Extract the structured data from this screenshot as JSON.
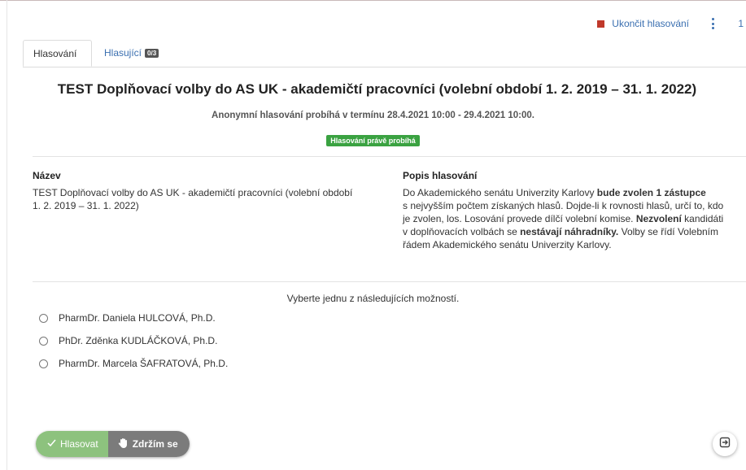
{
  "header": {
    "end_vote_label": "Ukončit hlasování",
    "cut_number": "1"
  },
  "tabs": [
    {
      "label": "Hlasování",
      "active": true
    },
    {
      "label": "Hlasující",
      "badge": "0/3",
      "active": false
    }
  ],
  "poll": {
    "title": "TEST Doplňovací volby do AS UK - akademičtí pracovníci (volební období 1. 2. 2019 – 31. 1. 2022)",
    "subtitle": "Anonymní hlasování probíhá v termínu 28.4.2021 10:00 - 29.4.2021 10:00.",
    "status": "Hlasování právě probíhá",
    "name_label": "Název",
    "name_line1": "TEST Doplňovací volby do AS UK - akademičtí pracovníci (volební období",
    "name_line2": "1. 2. 2019 – 31. 1. 2022)",
    "desc_label": "Popis hlasování",
    "desc": {
      "p1": "Do Akademického senátu Univerzity Karlovy ",
      "b1": "bude zvolen 1 zástupce",
      "p2": "s nejvyšším počtem získaných hlasů. Dojde-li k rovnosti hlasů, určí to, kdo",
      "p3": "je zvolen, los. Losování provede dílčí volební komise. ",
      "b2": "Nezvolení",
      "p4": " kandidáti",
      "p5": "v doplňovacích volbách se ",
      "b3": "nestávají náhradníky.",
      "p6": " Volby se řídí Volebním",
      "p7": "řádem Akademického senátu Univerzity Karlovy."
    },
    "choose_label": "Vyberte jednu z následujících možností.",
    "options": [
      "PharmDr. Daniela HULCOVÁ, Ph.D.",
      "PhDr. Zděnka KUDLÁČKOVÁ, Ph.D.",
      "PharmDr. Marcela ŠAFRATOVÁ, Ph.D."
    ]
  },
  "actions": {
    "vote_label": "Hlasovat",
    "abstain_label": "Zdržím se"
  },
  "icons": {
    "end_vote": "stop-square-icon",
    "menu": "kebab-icon",
    "vote": "check-icon",
    "abstain": "hand-icon",
    "logout": "logout-icon"
  },
  "colors": {
    "link": "#3a6fb0",
    "stop": "#c0392b",
    "status": "#3aa241",
    "vote_button": "#8dc27e",
    "abstain_button": "#7b7b7b"
  }
}
